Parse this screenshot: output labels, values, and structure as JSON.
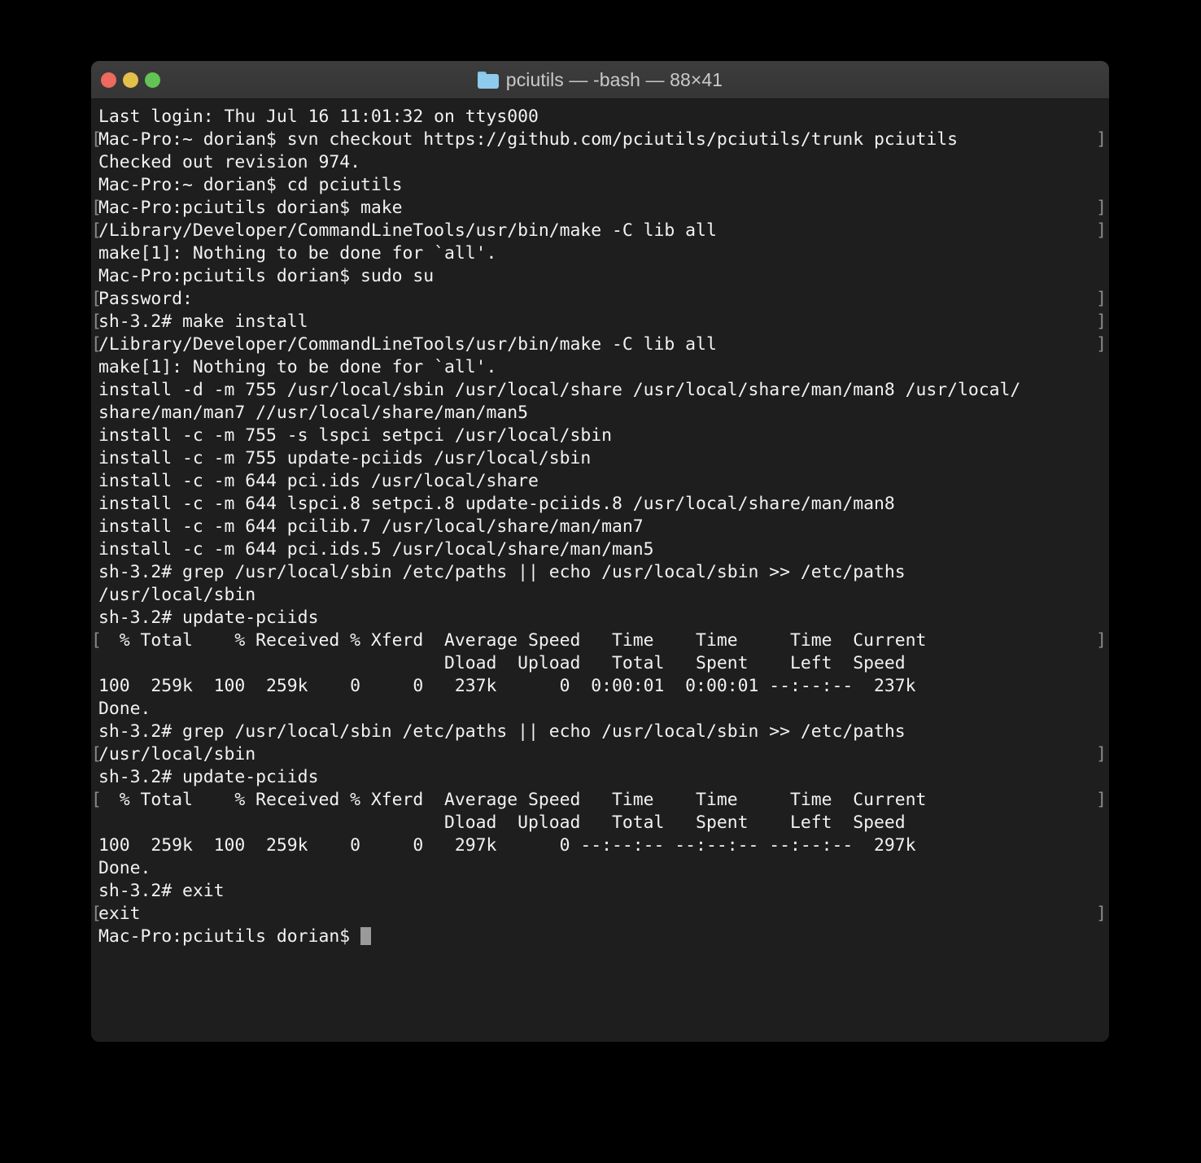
{
  "window": {
    "title": "pciutils — -bash — 88×41",
    "folder_icon": "folder-icon",
    "traffic_lights": {
      "close_label": "close",
      "minimize_label": "minimize",
      "maximize_label": "maximize",
      "close_color": "#ed6a5e",
      "minimize_color": "#e4c04a",
      "maximize_color": "#61c454"
    },
    "background_color": "#1e1e1e",
    "titlebar_color": "#3a3a3a",
    "text_color": "#f2f2f2",
    "marker_color": "#8a8a8a",
    "cursor_color": "#9a9a9a",
    "columns": 88,
    "rows": 41
  },
  "terminal": {
    "prompt_marker_open": "[",
    "prompt_marker_close": "]",
    "lines": [
      {
        "text": "Last login: Thu Jul 16 11:01:32 on ttys000",
        "marker_left": false,
        "marker_right": false
      },
      {
        "text": "Mac-Pro:~ dorian$ svn checkout https://github.com/pciutils/pciutils/trunk pciutils",
        "marker_left": true,
        "marker_right": true
      },
      {
        "text": "Checked out revision 974.",
        "marker_left": false,
        "marker_right": false
      },
      {
        "text": "Mac-Pro:~ dorian$ cd pciutils",
        "marker_left": false,
        "marker_right": false
      },
      {
        "text": "Mac-Pro:pciutils dorian$ make",
        "marker_left": true,
        "marker_right": true
      },
      {
        "text": "/Library/Developer/CommandLineTools/usr/bin/make -C lib all",
        "marker_left": true,
        "marker_right": true
      },
      {
        "text": "make[1]: Nothing to be done for `all'.",
        "marker_left": false,
        "marker_right": false
      },
      {
        "text": "Mac-Pro:pciutils dorian$ sudo su",
        "marker_left": false,
        "marker_right": false
      },
      {
        "text": "Password:",
        "marker_left": true,
        "marker_right": true
      },
      {
        "text": "sh-3.2# make install",
        "marker_left": true,
        "marker_right": true
      },
      {
        "text": "/Library/Developer/CommandLineTools/usr/bin/make -C lib all",
        "marker_left": true,
        "marker_right": true
      },
      {
        "text": "make[1]: Nothing to be done for `all'.",
        "marker_left": false,
        "marker_right": false
      },
      {
        "text": "install -d -m 755 /usr/local/sbin /usr/local/share /usr/local/share/man/man8 /usr/local/",
        "marker_left": false,
        "marker_right": false
      },
      {
        "text": "share/man/man7 //usr/local/share/man/man5",
        "marker_left": false,
        "marker_right": false
      },
      {
        "text": "install -c -m 755 -s lspci setpci /usr/local/sbin",
        "marker_left": false,
        "marker_right": false
      },
      {
        "text": "install -c -m 755 update-pciids /usr/local/sbin",
        "marker_left": false,
        "marker_right": false
      },
      {
        "text": "install -c -m 644 pci.ids /usr/local/share",
        "marker_left": false,
        "marker_right": false
      },
      {
        "text": "install -c -m 644 lspci.8 setpci.8 update-pciids.8 /usr/local/share/man/man8",
        "marker_left": false,
        "marker_right": false
      },
      {
        "text": "install -c -m 644 pcilib.7 /usr/local/share/man/man7",
        "marker_left": false,
        "marker_right": false
      },
      {
        "text": "install -c -m 644 pci.ids.5 /usr/local/share/man/man5",
        "marker_left": false,
        "marker_right": false
      },
      {
        "text": "sh-3.2# grep /usr/local/sbin /etc/paths || echo /usr/local/sbin >> /etc/paths",
        "marker_left": false,
        "marker_right": false
      },
      {
        "text": "/usr/local/sbin",
        "marker_left": false,
        "marker_right": false
      },
      {
        "text": "sh-3.2# update-pciids",
        "marker_left": false,
        "marker_right": false
      },
      {
        "text": "  % Total    % Received % Xferd  Average Speed   Time    Time     Time  Current",
        "marker_left": true,
        "marker_right": true
      },
      {
        "text": "                                 Dload  Upload   Total   Spent    Left  Speed",
        "marker_left": false,
        "marker_right": false
      },
      {
        "text": "100  259k  100  259k    0     0   237k      0  0:00:01  0:00:01 --:--:--  237k",
        "marker_left": false,
        "marker_right": false
      },
      {
        "text": "Done.",
        "marker_left": false,
        "marker_right": false
      },
      {
        "text": "sh-3.2# grep /usr/local/sbin /etc/paths || echo /usr/local/sbin >> /etc/paths",
        "marker_left": false,
        "marker_right": false
      },
      {
        "text": "/usr/local/sbin",
        "marker_left": true,
        "marker_right": true
      },
      {
        "text": "sh-3.2# update-pciids",
        "marker_left": false,
        "marker_right": false
      },
      {
        "text": "  % Total    % Received % Xferd  Average Speed   Time    Time     Time  Current",
        "marker_left": true,
        "marker_right": true
      },
      {
        "text": "                                 Dload  Upload   Total   Spent    Left  Speed",
        "marker_left": false,
        "marker_right": false
      },
      {
        "text": "100  259k  100  259k    0     0   297k      0 --:--:-- --:--:-- --:--:--  297k",
        "marker_left": false,
        "marker_right": false
      },
      {
        "text": "Done.",
        "marker_left": false,
        "marker_right": false
      },
      {
        "text": "sh-3.2# exit",
        "marker_left": false,
        "marker_right": false
      },
      {
        "text": "exit",
        "marker_left": true,
        "marker_right": true
      }
    ],
    "final_prompt": "Mac-Pro:pciutils dorian$ "
  }
}
